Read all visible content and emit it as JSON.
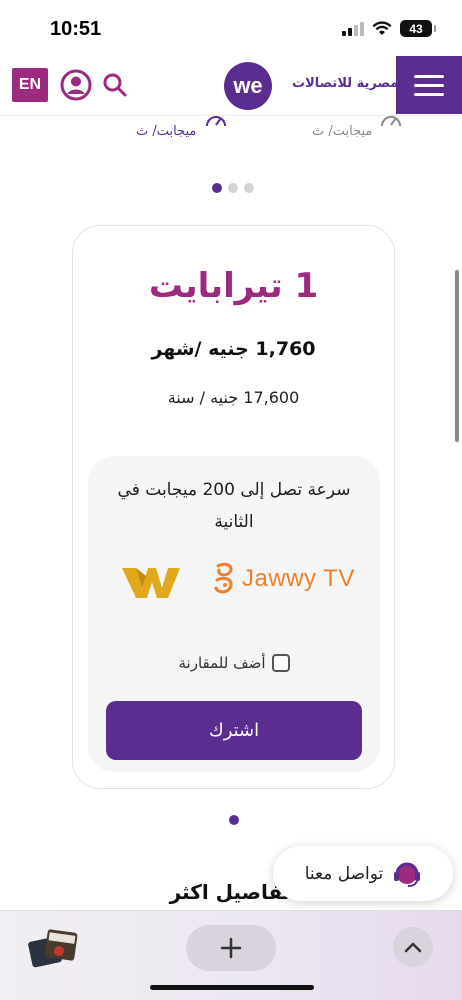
{
  "status_bar": {
    "time": "10:51",
    "battery": "43"
  },
  "header": {
    "lang_label": "EN",
    "logo_we": "we",
    "logo_text": "المصرية للاتصالات",
    "brand_color": "#5c2d91",
    "accent_color": "#9c2a7e"
  },
  "speed_row": {
    "left_unit": "ميجابت/ ث",
    "right_unit": "ميجابت/ ث"
  },
  "carousel": {
    "dot_count": 3,
    "active_index": 0
  },
  "plan": {
    "title": "1 تيرابايت",
    "price_month": "1,760 جنيه /شهر",
    "price_year": "17,600 جنيه / سنة",
    "speed_text": "سرعة تصل إلى 200 ميجابت في الثانية",
    "partner_jawwy": "Jawwy TV",
    "compare_label": "أضف للمقارنة",
    "subscribe_label": "اشترك"
  },
  "section": {
    "title": "تفاصيل اكثر"
  },
  "contact": {
    "label": "تواصل معنا"
  },
  "browser": {
    "icons": [
      "tabs-thumbnail",
      "plus-icon",
      "chevron-up-icon"
    ]
  }
}
